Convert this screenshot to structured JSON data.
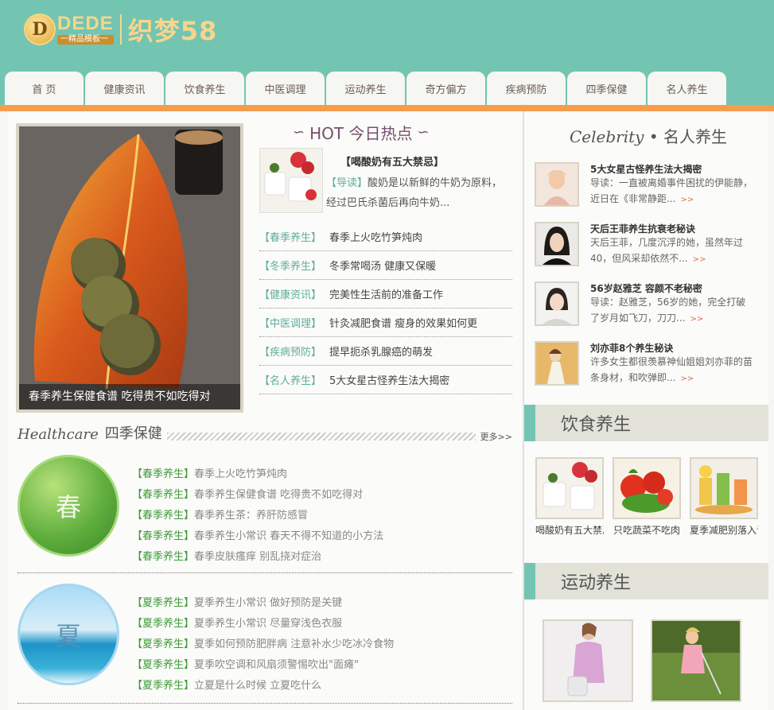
{
  "logo": {
    "badge": "D",
    "brand": "DEDE",
    "tagline": "一精品模板一",
    "name": "织梦58"
  },
  "nav": [
    "首 页",
    "健康资讯",
    "饮食养生",
    "中医调理",
    "运动养生",
    "奇方偏方",
    "疾病预防",
    "四季保健",
    "名人养生"
  ],
  "feature": {
    "caption": "春季养生保健食谱 吃得贵不如吃得对"
  },
  "hot": {
    "title": "HOT 今日热点",
    "headline": "【喝酸奶有五大禁忌】",
    "desc_label": "【导读】",
    "desc": "酸奶是以新鲜的牛奶为原料，经过巴氏杀菌后再向牛奶...",
    "list": [
      {
        "cat": "【春季养生】",
        "text": "春季上火吃竹笋炖肉"
      },
      {
        "cat": "【冬季养生】",
        "text": "冬季常喝汤 健康又保暖"
      },
      {
        "cat": "【健康资讯】",
        "text": "完美性生活前的准备工作"
      },
      {
        "cat": "【中医调理】",
        "text": "针灸减肥食谱 瘦身的效果如何更"
      },
      {
        "cat": "【疾病预防】",
        "text": "提早扼杀乳腺癌的萌发"
      },
      {
        "cat": "【名人养生】",
        "text": "5大女星古怪养生法大揭密"
      }
    ]
  },
  "healthcare": {
    "en": "Healthcare",
    "cn": "四季保健",
    "more": "更多>>",
    "spring": {
      "label": "春",
      "items": [
        {
          "cat": "【春季养生】",
          "text": "春季上火吃竹笋炖肉"
        },
        {
          "cat": "【春季养生】",
          "text": "春季养生保健食谱 吃得贵不如吃得对"
        },
        {
          "cat": "【春季养生】",
          "text": "春季养生茶：养肝防感冒"
        },
        {
          "cat": "【春季养生】",
          "text": "春季养生小常识 春天不得不知道的小方法"
        },
        {
          "cat": "【春季养生】",
          "text": "春季皮肤瘙痒 别乱挠对症治"
        }
      ]
    },
    "summer": {
      "label": "夏",
      "items": [
        {
          "cat": "【夏季养生】",
          "text": "夏季养生小常识 做好预防是关键"
        },
        {
          "cat": "【夏季养生】",
          "text": "夏季养生小常识 尽量穿浅色衣服"
        },
        {
          "cat": "【夏季养生】",
          "text": "夏季如何预防肥胖病 注意补水少吃冰冷食物"
        },
        {
          "cat": "【夏季养生】",
          "text": "夏季吹空调和风扇须警惕吹出\"面瘫\""
        },
        {
          "cat": "【夏季养生】",
          "text": "立夏是什么时候 立夏吃什么"
        }
      ]
    }
  },
  "celebrity": {
    "title_en": "Celebrity",
    "title_cn": "• 名人养生",
    "more": ">>",
    "items": [
      {
        "name": "5大女星古怪养生法大揭密",
        "desc": "导读：一直被离婚事件困扰的伊能静，近日在《非常静距..."
      },
      {
        "name": "天后王菲养生抗衰老秘诀",
        "desc": "天后王菲，几度沉浮的她，虽然年过40，但风采却依然不..."
      },
      {
        "name": "56岁赵雅芝 容颜不老秘密",
        "desc": "导读：赵雅芝，56岁的她，完全打破了岁月如飞刀，刀刀..."
      },
      {
        "name": "刘亦菲8个养生秘诀",
        "desc": "许多女生都很羡慕神仙姐姐刘亦菲的苗条身材，和吹弹即..."
      }
    ]
  },
  "food": {
    "title": "饮食养生",
    "items": [
      "喝酸奶有五大禁忌",
      "只吃蔬菜不吃肉",
      "夏季减肥别落入误区"
    ]
  },
  "sport": {
    "title": "运动养生"
  }
}
